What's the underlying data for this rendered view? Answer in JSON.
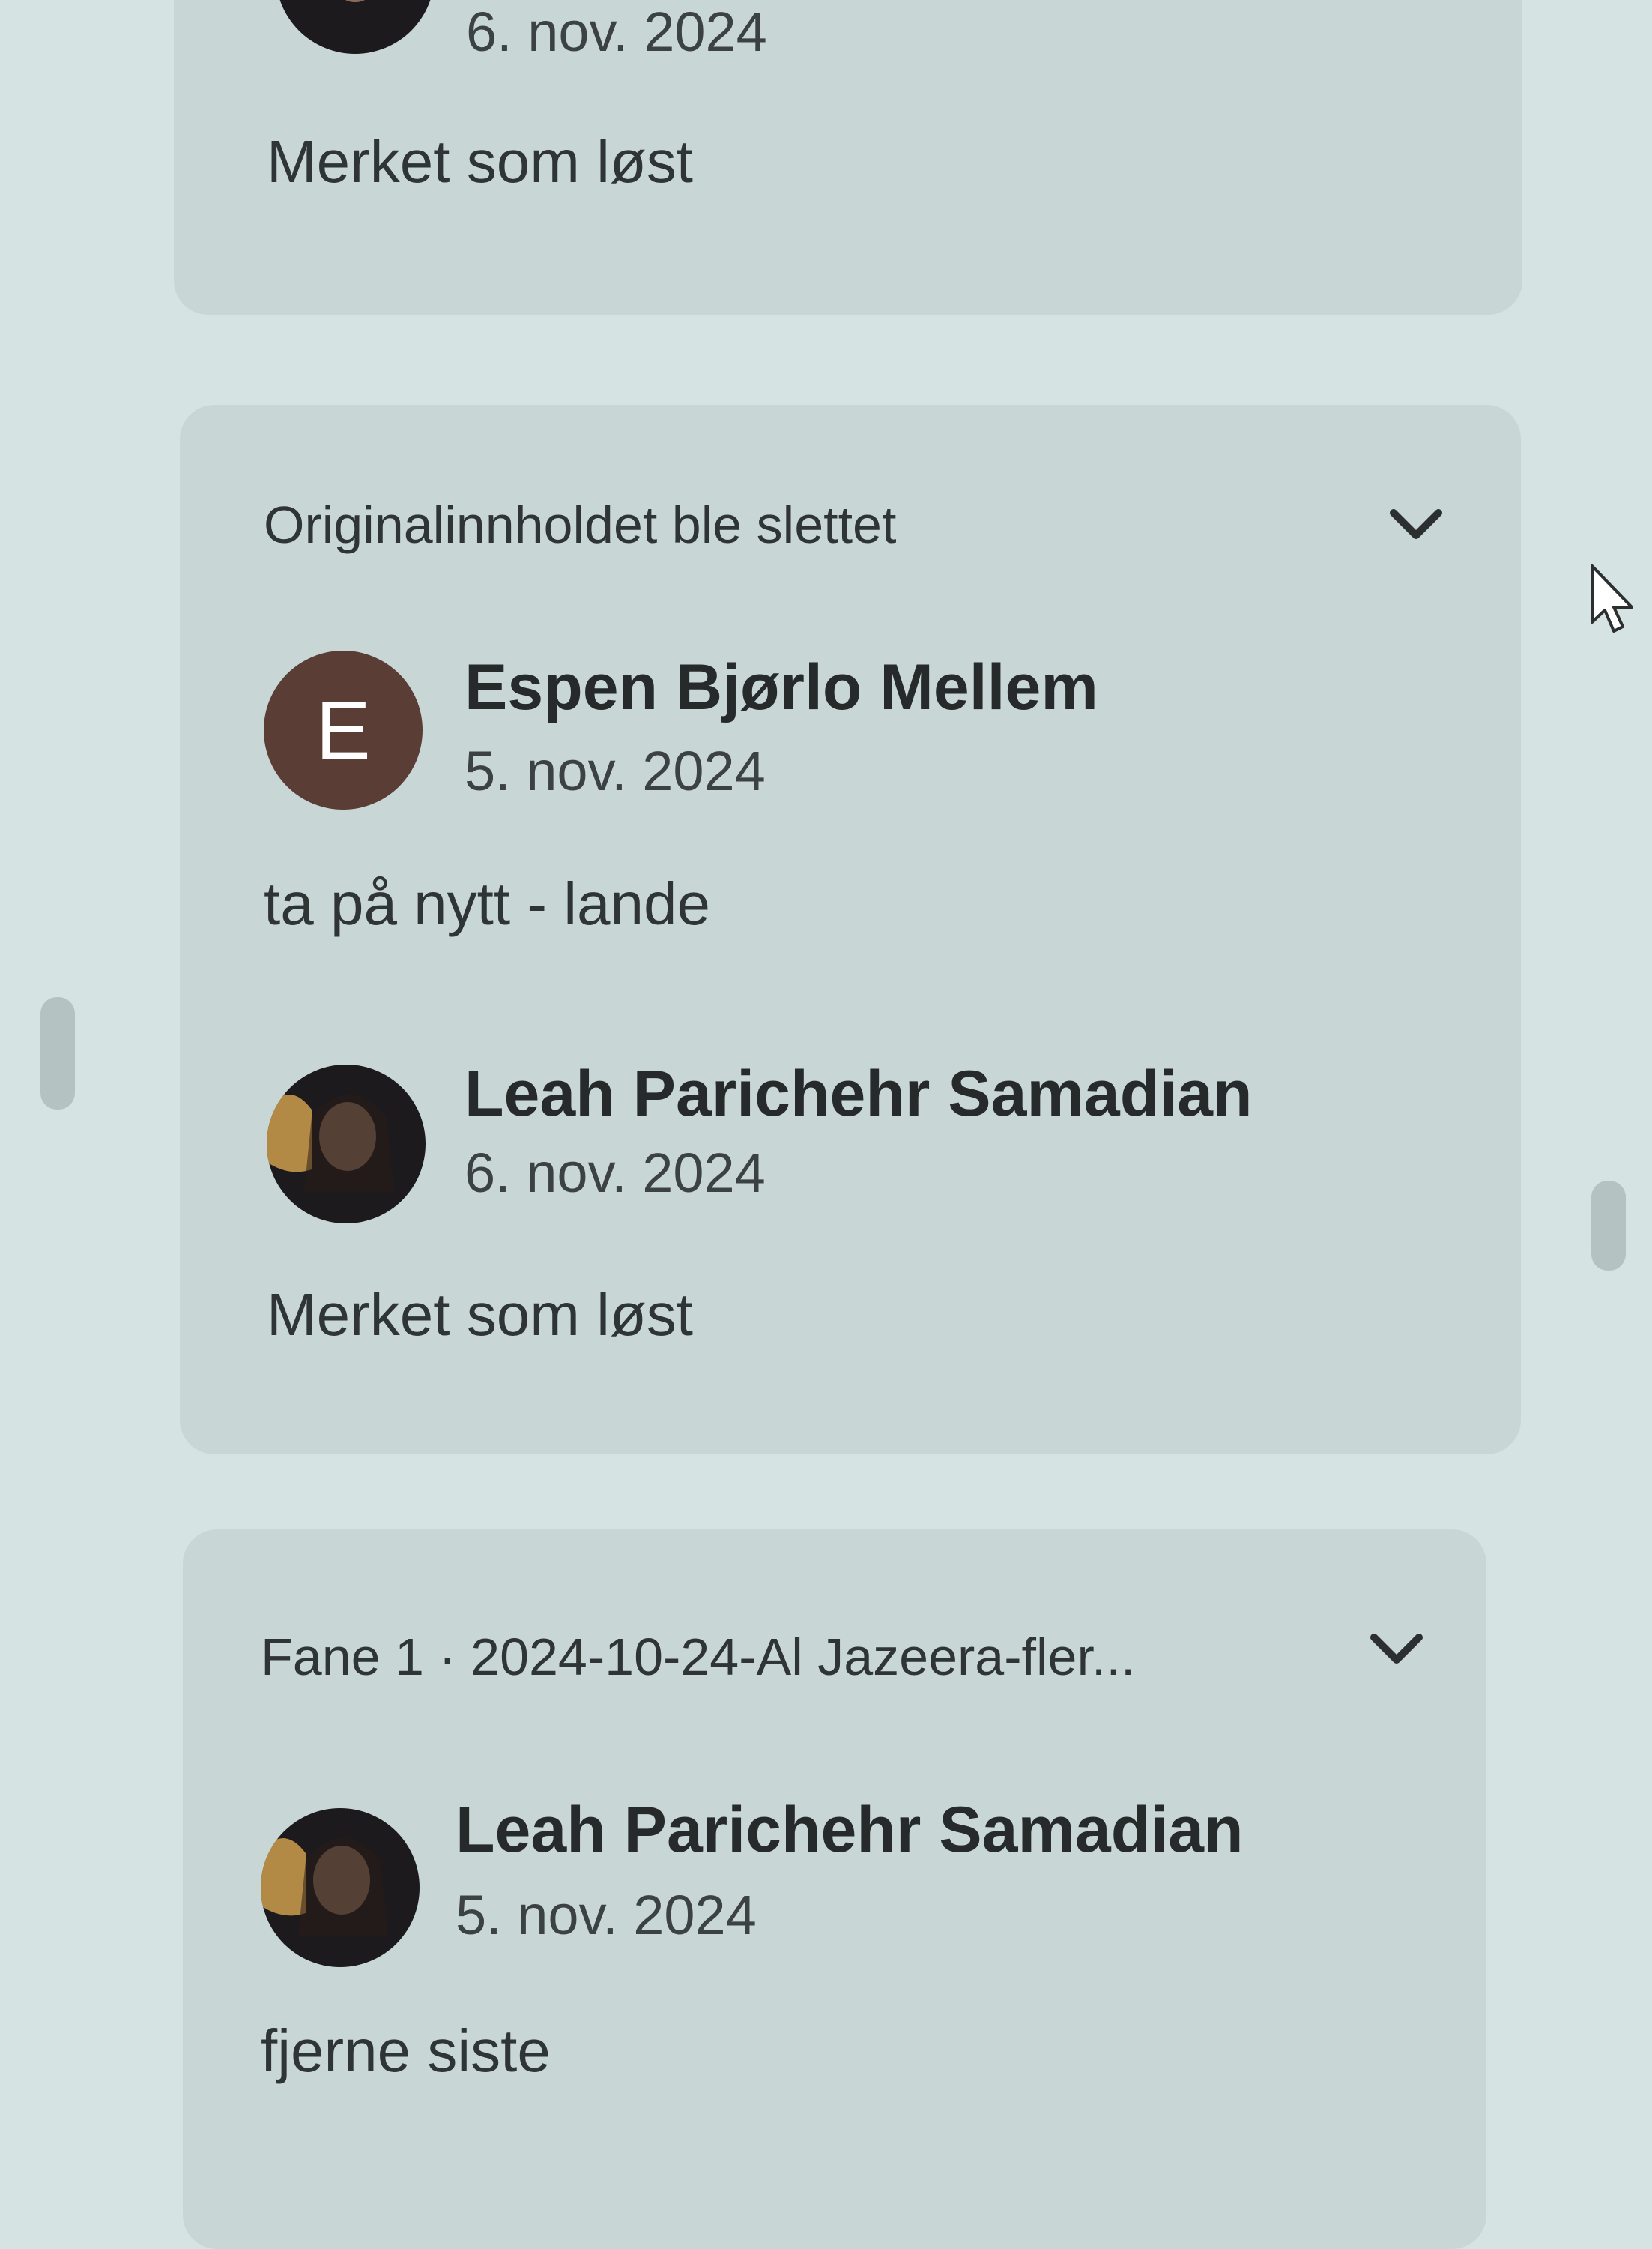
{
  "thread_prev": {
    "date": "6. nov. 2024",
    "message": "Merket som løst"
  },
  "thread_deleted": {
    "header": "Originalinnholdet ble slettet",
    "comments": [
      {
        "author": "Espen Bjørlo Mellem",
        "avatar_initial": "E",
        "date": "5. nov. 2024",
        "message": "ta på nytt - lande"
      },
      {
        "author": "Leah Parichehr Samadian",
        "date": "6. nov. 2024",
        "message": "Merket som løst"
      }
    ]
  },
  "thread_tab": {
    "header": "Fane 1 · 2024-10-24-Al Jazeera-fler...",
    "comments": [
      {
        "author": "Leah Parichehr Samadian",
        "date": "5. nov. 2024",
        "message": "fjerne siste"
      }
    ]
  },
  "icons": {
    "expand": "chevron-down-icon",
    "cursor": "mouse-pointer-icon"
  },
  "colors": {
    "background": "#d6e3e3",
    "card": "#c8d6d6",
    "avatar_initial_bg": "#5a3d35"
  }
}
